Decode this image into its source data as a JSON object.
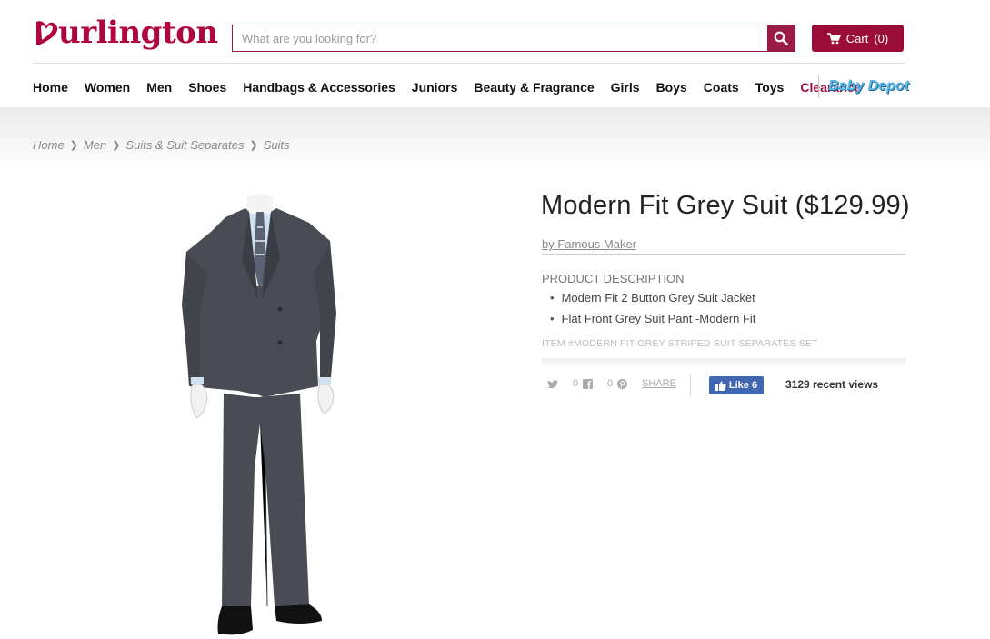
{
  "brand": {
    "logo_text": "urlington",
    "logo_full": "Burlington",
    "color": "#b0053c"
  },
  "search": {
    "placeholder": "What are you looking for?",
    "value": ""
  },
  "cart": {
    "label": "Cart",
    "count": "(0)"
  },
  "nav": {
    "items": [
      "Home",
      "Women",
      "Men",
      "Shoes",
      "Handbags & Accessories",
      "Juniors",
      "Beauty & Fragrance",
      "Girls",
      "Boys",
      "Coats",
      "Toys",
      "Clearance"
    ],
    "baby_depot": "Baby Depot"
  },
  "breadcrumb": [
    "Home",
    "Men",
    "Suits & Suit Separates",
    "Suits"
  ],
  "product": {
    "title": "Modern Fit Grey Suit ($129.99)",
    "maker": "by Famous Maker",
    "description_label": "PRODUCT DESCRIPTION",
    "bullets": [
      "Modern Fit 2 Button Grey Suit Jacket",
      "Flat Front Grey Suit Pant -Modern Fit"
    ],
    "item_number": "ITEM #MODERN FIT GREY STRIPED SUIT SEPARATES SET"
  },
  "social": {
    "twitter_count": "0",
    "facebook_count": "0",
    "share_label": "SHARE",
    "like_label": "Like 6",
    "views": "3129 recent views"
  },
  "colors": {
    "accent": "#9b0d38",
    "baby_depot": "#5fb7e5",
    "facebook": "#4267b2"
  }
}
